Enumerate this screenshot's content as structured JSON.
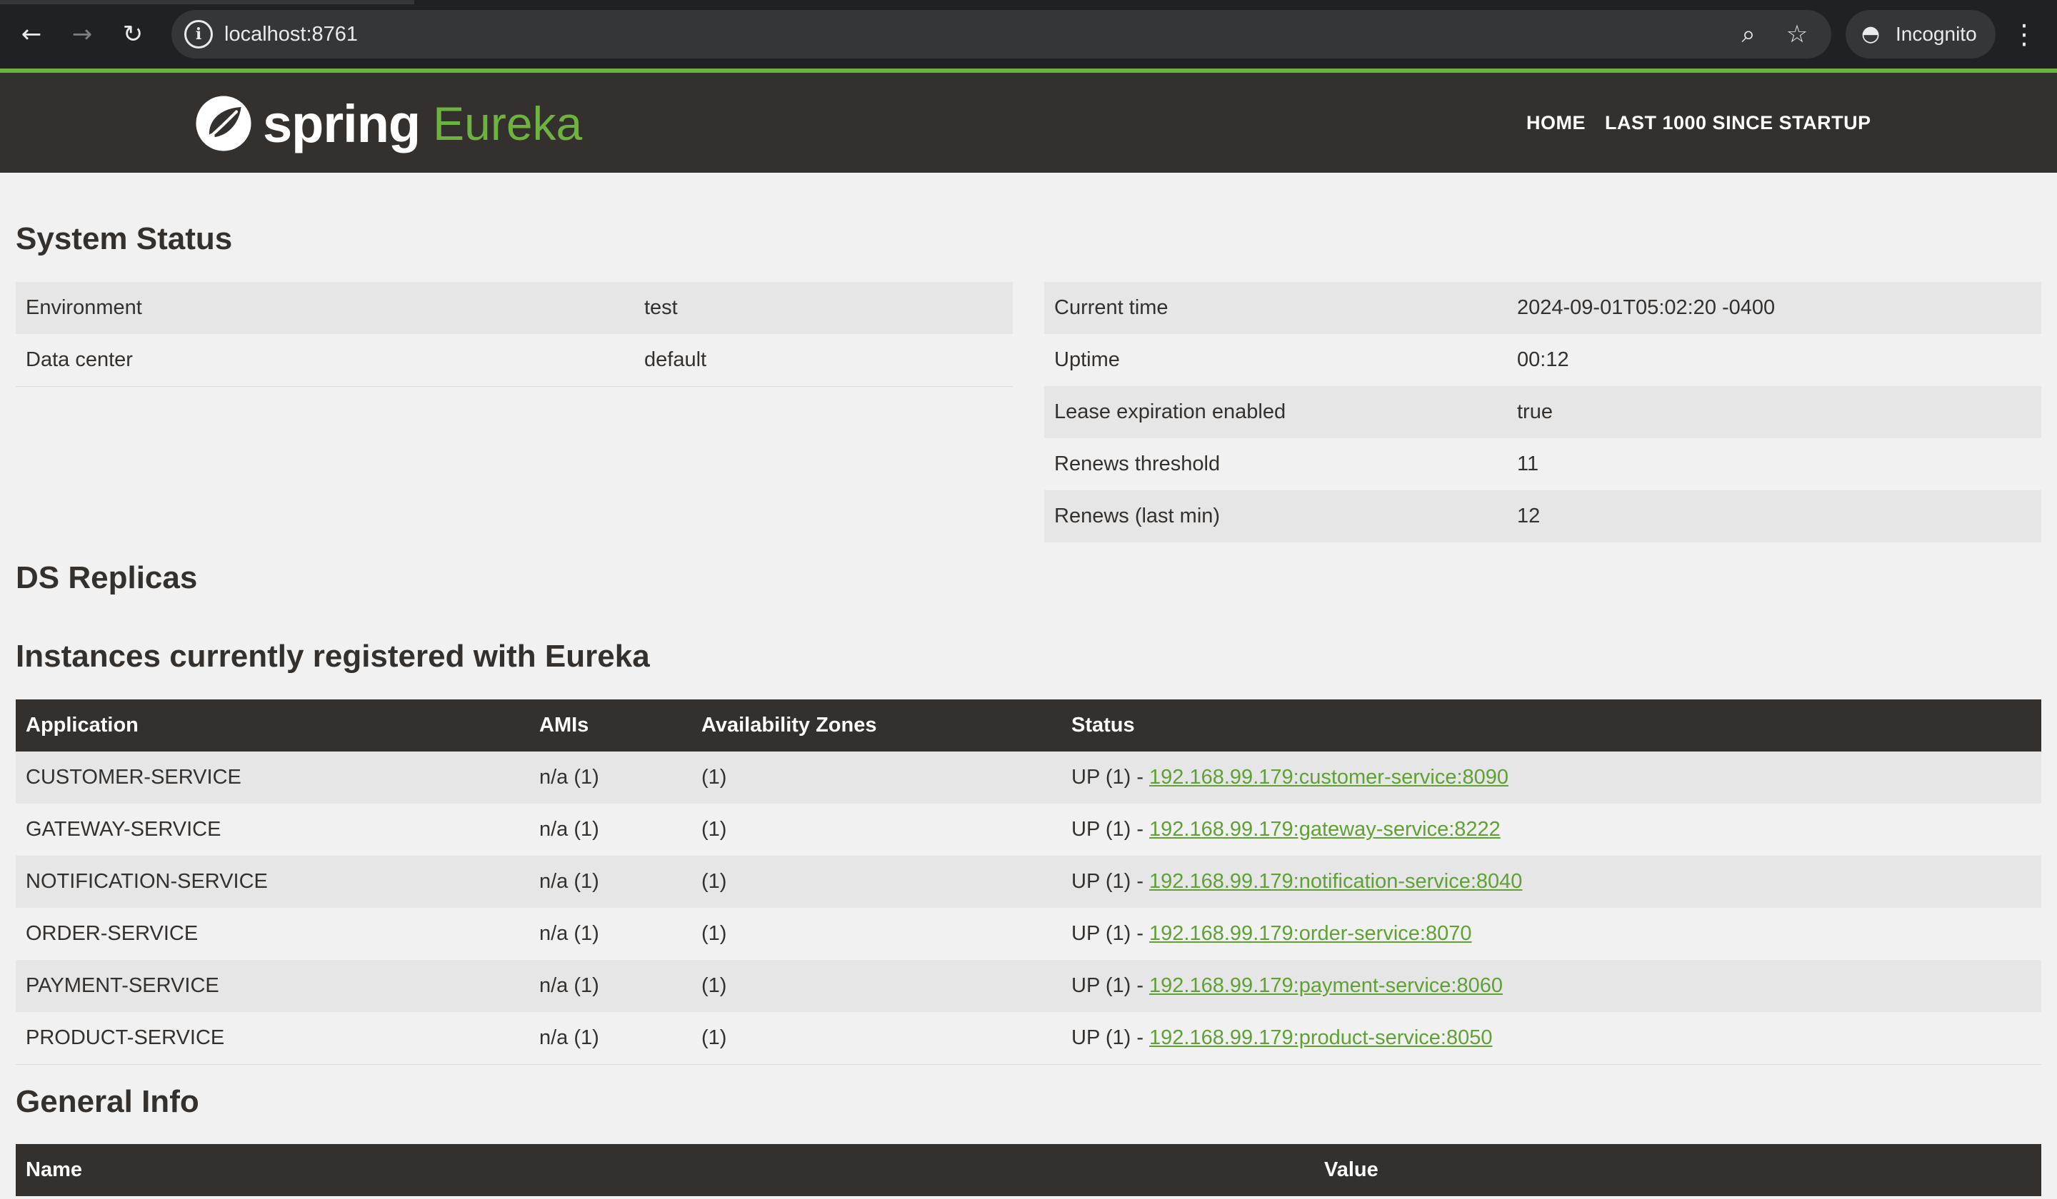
{
  "browser": {
    "url": "localhost:8761",
    "incognito_label": "Incognito"
  },
  "navbar": {
    "brand_spring": "spring",
    "brand_eureka": "Eureka",
    "links": [
      "HOME",
      "LAST 1000 SINCE STARTUP"
    ]
  },
  "system_status": {
    "title": "System Status",
    "left": [
      {
        "label": "Environment",
        "value": "test"
      },
      {
        "label": "Data center",
        "value": "default"
      }
    ],
    "right": [
      {
        "label": "Current time",
        "value": "2024-09-01T05:02:20 -0400"
      },
      {
        "label": "Uptime",
        "value": "00:12"
      },
      {
        "label": "Lease expiration enabled",
        "value": "true"
      },
      {
        "label": "Renews threshold",
        "value": "11"
      },
      {
        "label": "Renews (last min)",
        "value": "12"
      }
    ]
  },
  "ds_replicas": {
    "title": "DS Replicas"
  },
  "instances": {
    "title": "Instances currently registered with Eureka",
    "headers": [
      "Application",
      "AMIs",
      "Availability Zones",
      "Status"
    ],
    "rows": [
      {
        "application": "CUSTOMER-SERVICE",
        "amis": "n/a (1)",
        "zones": "(1)",
        "status_prefix": "UP (1) - ",
        "link": "192.168.99.179:customer-service:8090"
      },
      {
        "application": "GATEWAY-SERVICE",
        "amis": "n/a (1)",
        "zones": "(1)",
        "status_prefix": "UP (1) - ",
        "link": "192.168.99.179:gateway-service:8222"
      },
      {
        "application": "NOTIFICATION-SERVICE",
        "amis": "n/a (1)",
        "zones": "(1)",
        "status_prefix": "UP (1) - ",
        "link": "192.168.99.179:notification-service:8040"
      },
      {
        "application": "ORDER-SERVICE",
        "amis": "n/a (1)",
        "zones": "(1)",
        "status_prefix": "UP (1) - ",
        "link": "192.168.99.179:order-service:8070"
      },
      {
        "application": "PAYMENT-SERVICE",
        "amis": "n/a (1)",
        "zones": "(1)",
        "status_prefix": "UP (1) - ",
        "link": "192.168.99.179:payment-service:8060"
      },
      {
        "application": "PRODUCT-SERVICE",
        "amis": "n/a (1)",
        "zones": "(1)",
        "status_prefix": "UP (1) - ",
        "link": "192.168.99.179:product-service:8050"
      }
    ]
  },
  "general_info": {
    "title": "General Info",
    "headers": [
      "Name",
      "Value"
    ]
  },
  "colors": {
    "spring_green": "#6db33f",
    "navbar_bg": "#34302d",
    "link": "#5fa134"
  }
}
